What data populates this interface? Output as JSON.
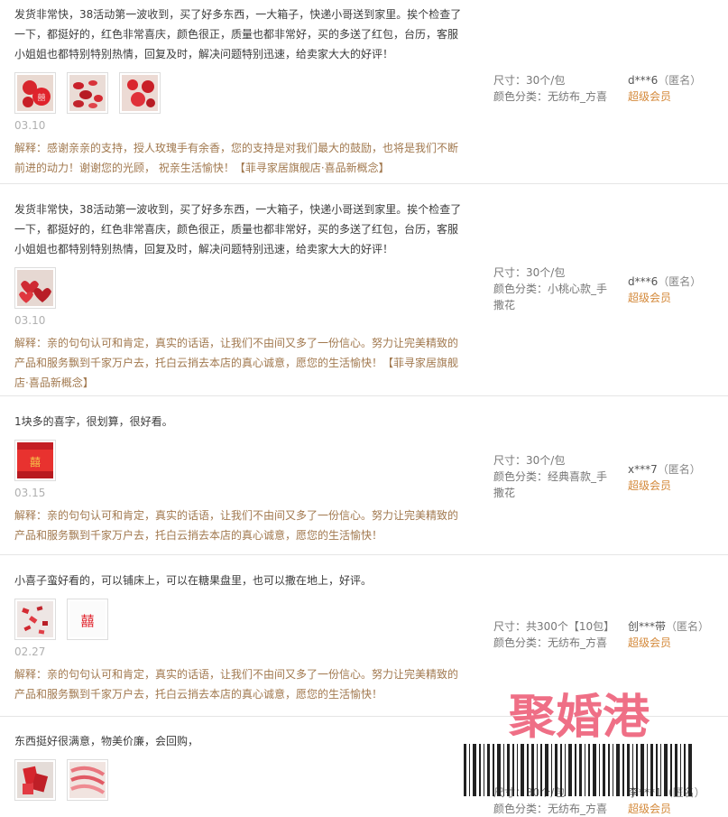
{
  "reviews": [
    {
      "text": "发货非常快，38活动第一波收到，买了好多东西，一大箱子，快递小哥送到家里。挨个检查了一下，都挺好的，红色非常喜庆，颜色很正，质量也都非常好，买的多送了红包，台历，客服小姐姐也都特别特别热情，回复及时，解决问题特别迅速，给卖家大大的好评！",
      "date": "03.10",
      "reply": "解释：感谢亲亲的支持，授人玫瑰手有余香，您的支持是对我们最大的鼓励，也将是我们不断前进的动力！谢谢您的光顾， 祝亲生活愉快！【菲寻家居旗舰店·喜品新概念】",
      "size": "尺寸：30个/包",
      "color": "颜色分类：无纺布_方喜",
      "user": "d***6",
      "anon": "（匿名）",
      "level": "超级会员",
      "images": [
        "round-red-xi-icon",
        "red-petals-icon",
        "red-balls-icon"
      ]
    },
    {
      "text": "发货非常快，38活动第一波收到，买了好多东西，一大箱子，快递小哥送到家里。挨个检查了一下，都挺好的，红色非常喜庆，颜色很正，质量也都非常好，买的多送了红包，台历，客服小姐姐也都特别特别热情，回复及时，解决问题特别迅速，给卖家大大的好评！",
      "date": "03.10",
      "reply": "解释：亲的句句认可和肯定，真实的话语，让我们不由间又多了一份信心。努力让完美精致的产品和服务飘到千家万户去，托白云捎去本店的真心诚意，愿您的生活愉快！【菲寻家居旗舰店·喜品新概念】",
      "size": "尺寸：30个/包",
      "color": "颜色分类：小桃心款_手撒花",
      "user": "d***6",
      "anon": "（匿名）",
      "level": "超级会员",
      "images": [
        "red-hearts-icon"
      ]
    },
    {
      "text": "1块多的喜字，很划算，很好看。",
      "date": "03.15",
      "reply": "解释：亲的句句认可和肯定，真实的话语，让我们不由间又多了一份信心。努力让完美精致的产品和服务飘到千家万户去，托白云捎去本店的真心诚意，愿您的生活愉快！",
      "size": "尺寸：30个/包",
      "color": "颜色分类：经典喜款_手撒花",
      "user": "x***7",
      "anon": "（匿名）",
      "level": "超级会员",
      "images": [
        "red-xi-cutout-icon"
      ]
    },
    {
      "text": "小喜子蛮好看的，可以铺床上，可以在糖果盘里，也可以撒在地上，好评。",
      "date": "02.27",
      "reply": "解释：亲的句句认可和肯定，真实的话语，让我们不由间又多了一份信心。努力让完美精致的产品和服务飘到千家万户去，托白云捎去本店的真心诚意，愿您的生活愉快！",
      "size": "尺寸：共300个【10包】",
      "color": "颜色分类：无纺布_方喜",
      "user": "创***带",
      "anon": "（匿名）",
      "level": "超级会员",
      "images": [
        "scattered-confetti-icon",
        "xi-character-icon"
      ]
    },
    {
      "text": "东西挺好很满意，物美价廉，会回购，",
      "date": "",
      "reply": "",
      "size": "尺寸：30个/包",
      "color": "颜色分类：无纺布_方喜",
      "user": "李***1",
      "anon": "（匿名）",
      "level": "超级会员",
      "images": [
        "red-xi-pile-icon",
        "pink-ribbon-icon"
      ]
    }
  ],
  "watermark": {
    "brand": "聚婚港",
    "brand_color": "#ef6f86"
  },
  "colors": {
    "reply": "#a1784e",
    "level": "#d4893a",
    "date": "#b0b0b0"
  }
}
